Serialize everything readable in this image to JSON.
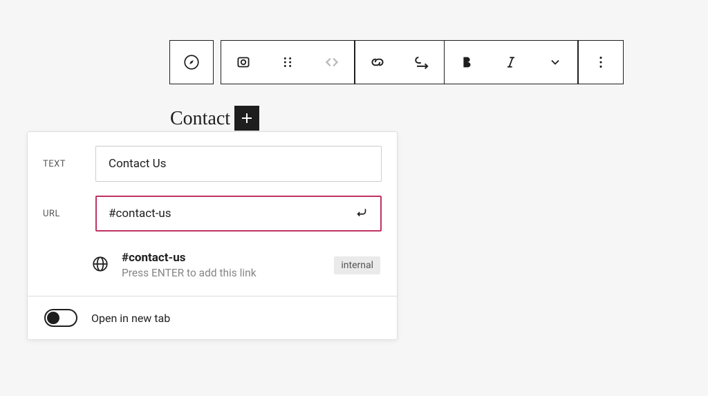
{
  "content": {
    "text": "Contact"
  },
  "link_panel": {
    "text_label": "TEXT",
    "text_value": "Contact Us",
    "url_label": "URL",
    "url_value": "#contact-us",
    "suggestion": {
      "title": "#contact-us",
      "subtitle": "Press ENTER to add this link",
      "badge": "internal"
    },
    "open_new_tab": "Open in new tab"
  }
}
